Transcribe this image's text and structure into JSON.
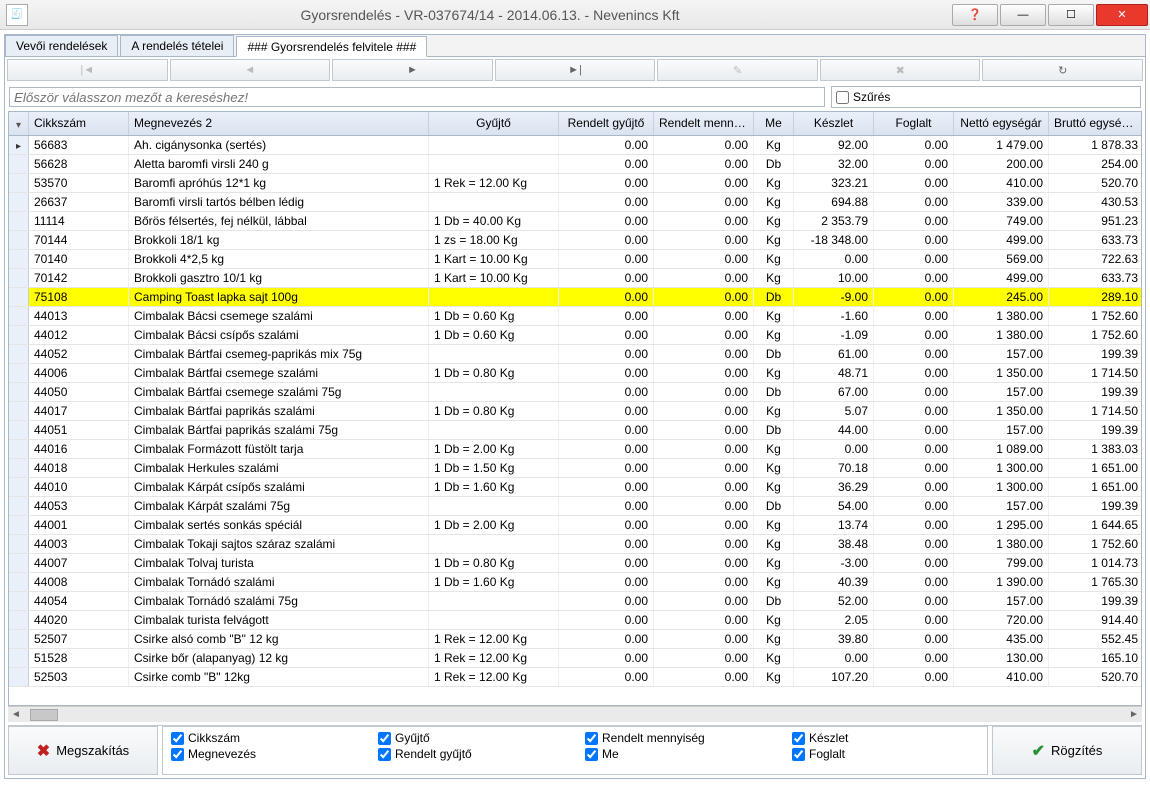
{
  "title": "Gyorsrendelés  -  VR-037674/14  -  2014.06.13.  -  Nevenincs Kft",
  "tabs": [
    {
      "label": "Vevői rendelések"
    },
    {
      "label": "A rendelés tételei"
    },
    {
      "label": "### Gyorsrendelés felvitele ###",
      "active": true
    }
  ],
  "nav": {
    "first": "|◄",
    "prev": "◄",
    "next": "►",
    "last": "►|",
    "edit": "✎",
    "delete": "✖",
    "refresh": "↻"
  },
  "search_placeholder": "Először válasszon mezőt a kereséshez!",
  "filter_label": "Szűrés",
  "columns": [
    "",
    "Cikkszám",
    "Megnevezés  2",
    "Gyűjtő",
    "Rendelt gyűjtő",
    "Rendelt mennyiség",
    "Me",
    "Készlet",
    "Foglalt",
    "Nettó egységár",
    "Bruttó egységár"
  ],
  "rows": [
    {
      "mark": true,
      "c": "56683",
      "n": "Ah. cigánysonka (sertés)",
      "g": "",
      "rg": "0.00",
      "rm": "0.00",
      "me": "Kg",
      "k": "92.00",
      "f": "0.00",
      "ne": "1 479.00",
      "be": "1 878.33"
    },
    {
      "c": "56628",
      "n": "Aletta baromfi virsli 240 g",
      "g": "",
      "rg": "0.00",
      "rm": "0.00",
      "me": "Db",
      "k": "32.00",
      "f": "0.00",
      "ne": "200.00",
      "be": "254.00"
    },
    {
      "c": "53570",
      "n": "Baromfi apróhús 12*1 kg",
      "g": "1 Rek = 12.00 Kg",
      "rg": "0.00",
      "rm": "0.00",
      "me": "Kg",
      "k": "323.21",
      "f": "0.00",
      "ne": "410.00",
      "be": "520.70"
    },
    {
      "c": "26637",
      "n": "Baromfi virsli tartós bélben lédig",
      "g": "",
      "rg": "0.00",
      "rm": "0.00",
      "me": "Kg",
      "k": "694.88",
      "f": "0.00",
      "ne": "339.00",
      "be": "430.53"
    },
    {
      "c": "11114",
      "n": "Bőrös félsertés, fej nélkül, lábbal",
      "g": "1 Db = 40.00 Kg",
      "rg": "0.00",
      "rm": "0.00",
      "me": "Kg",
      "k": "2 353.79",
      "f": "0.00",
      "ne": "749.00",
      "be": "951.23"
    },
    {
      "c": "70144",
      "n": "Brokkoli 18/1 kg",
      "g": "1 zs = 18.00 Kg",
      "rg": "0.00",
      "rm": "0.00",
      "me": "Kg",
      "k": "-18 348.00",
      "f": "0.00",
      "ne": "499.00",
      "be": "633.73"
    },
    {
      "c": "70140",
      "n": "Brokkoli 4*2,5 kg",
      "g": "1 Kart = 10.00 Kg",
      "rg": "0.00",
      "rm": "0.00",
      "me": "Kg",
      "k": "0.00",
      "f": "0.00",
      "ne": "569.00",
      "be": "722.63"
    },
    {
      "c": "70142",
      "n": "Brokkoli gasztro 10/1 kg",
      "g": "1 Kart = 10.00 Kg",
      "rg": "0.00",
      "rm": "0.00",
      "me": "Kg",
      "k": "10.00",
      "f": "0.00",
      "ne": "499.00",
      "be": "633.73"
    },
    {
      "hl": true,
      "c": "75108",
      "n": "Camping Toast lapka sajt 100g",
      "g": "",
      "rg": "0.00",
      "rm": "0.00",
      "me": "Db",
      "k": "-9.00",
      "f": "0.00",
      "ne": "245.00",
      "be": "289.10"
    },
    {
      "c": "44013",
      "n": "Cimbalak Bácsi csemege szalámi",
      "g": "1 Db = 0.60 Kg",
      "rg": "0.00",
      "rm": "0.00",
      "me": "Kg",
      "k": "-1.60",
      "f": "0.00",
      "ne": "1 380.00",
      "be": "1 752.60"
    },
    {
      "c": "44012",
      "n": "Cimbalak Bácsi csípős szalámi",
      "g": "1 Db = 0.60 Kg",
      "rg": "0.00",
      "rm": "0.00",
      "me": "Kg",
      "k": "-1.09",
      "f": "0.00",
      "ne": "1 380.00",
      "be": "1 752.60"
    },
    {
      "c": "44052",
      "n": "Cimbalak Bártfai csemeg-paprikás mix 75g",
      "g": "",
      "rg": "0.00",
      "rm": "0.00",
      "me": "Db",
      "k": "61.00",
      "f": "0.00",
      "ne": "157.00",
      "be": "199.39"
    },
    {
      "c": "44006",
      "n": "Cimbalak Bártfai csemege szalámi",
      "g": "1 Db = 0.80 Kg",
      "rg": "0.00",
      "rm": "0.00",
      "me": "Kg",
      "k": "48.71",
      "f": "0.00",
      "ne": "1 350.00",
      "be": "1 714.50"
    },
    {
      "c": "44050",
      "n": "Cimbalak Bártfai csemege szalámi 75g",
      "g": "",
      "rg": "0.00",
      "rm": "0.00",
      "me": "Db",
      "k": "67.00",
      "f": "0.00",
      "ne": "157.00",
      "be": "199.39"
    },
    {
      "c": "44017",
      "n": "Cimbalak Bártfai paprikás szalámi",
      "g": "1 Db = 0.80 Kg",
      "rg": "0.00",
      "rm": "0.00",
      "me": "Kg",
      "k": "5.07",
      "f": "0.00",
      "ne": "1 350.00",
      "be": "1 714.50"
    },
    {
      "c": "44051",
      "n": "Cimbalak Bártfai paprikás szalámi 75g",
      "g": "",
      "rg": "0.00",
      "rm": "0.00",
      "me": "Db",
      "k": "44.00",
      "f": "0.00",
      "ne": "157.00",
      "be": "199.39"
    },
    {
      "c": "44016",
      "n": "Cimbalak Formázott füstölt tarja",
      "g": "1 Db = 2.00 Kg",
      "rg": "0.00",
      "rm": "0.00",
      "me": "Kg",
      "k": "0.00",
      "f": "0.00",
      "ne": "1 089.00",
      "be": "1 383.03"
    },
    {
      "c": "44018",
      "n": "Cimbalak Herkules szalámi",
      "g": "1 Db = 1.50 Kg",
      "rg": "0.00",
      "rm": "0.00",
      "me": "Kg",
      "k": "70.18",
      "f": "0.00",
      "ne": "1 300.00",
      "be": "1 651.00"
    },
    {
      "c": "44010",
      "n": "Cimbalak Kárpát csípős szalámi",
      "g": "1 Db = 1.60 Kg",
      "rg": "0.00",
      "rm": "0.00",
      "me": "Kg",
      "k": "36.29",
      "f": "0.00",
      "ne": "1 300.00",
      "be": "1 651.00"
    },
    {
      "c": "44053",
      "n": "Cimbalak Kárpát szalámi 75g",
      "g": "",
      "rg": "0.00",
      "rm": "0.00",
      "me": "Db",
      "k": "54.00",
      "f": "0.00",
      "ne": "157.00",
      "be": "199.39"
    },
    {
      "c": "44001",
      "n": "Cimbalak sertés sonkás spéciál",
      "g": "1 Db = 2.00 Kg",
      "rg": "0.00",
      "rm": "0.00",
      "me": "Kg",
      "k": "13.74",
      "f": "0.00",
      "ne": "1 295.00",
      "be": "1 644.65"
    },
    {
      "c": "44003",
      "n": "Cimbalak Tokaji sajtos száraz szalámi",
      "g": "",
      "rg": "0.00",
      "rm": "0.00",
      "me": "Kg",
      "k": "38.48",
      "f": "0.00",
      "ne": "1 380.00",
      "be": "1 752.60"
    },
    {
      "c": "44007",
      "n": "Cimbalak Tolvaj turista",
      "g": "1 Db = 0.80 Kg",
      "rg": "0.00",
      "rm": "0.00",
      "me": "Kg",
      "k": "-3.00",
      "f": "0.00",
      "ne": "799.00",
      "be": "1 014.73"
    },
    {
      "c": "44008",
      "n": "Cimbalak Tornádó szalámi",
      "g": "1 Db = 1.60 Kg",
      "rg": "0.00",
      "rm": "0.00",
      "me": "Kg",
      "k": "40.39",
      "f": "0.00",
      "ne": "1 390.00",
      "be": "1 765.30"
    },
    {
      "c": "44054",
      "n": "Cimbalak Tornádó szalámi 75g",
      "g": "",
      "rg": "0.00",
      "rm": "0.00",
      "me": "Db",
      "k": "52.00",
      "f": "0.00",
      "ne": "157.00",
      "be": "199.39"
    },
    {
      "c": "44020",
      "n": "Cimbalak turista felvágott",
      "g": "",
      "rg": "0.00",
      "rm": "0.00",
      "me": "Kg",
      "k": "2.05",
      "f": "0.00",
      "ne": "720.00",
      "be": "914.40"
    },
    {
      "c": "52507",
      "n": "Csirke alsó comb \"B\" 12 kg",
      "g": "1 Rek = 12.00 Kg",
      "rg": "0.00",
      "rm": "0.00",
      "me": "Kg",
      "k": "39.80",
      "f": "0.00",
      "ne": "435.00",
      "be": "552.45"
    },
    {
      "c": "51528",
      "n": "Csirke bőr (alapanyag) 12 kg",
      "g": "1 Rek = 12.00 Kg",
      "rg": "0.00",
      "rm": "0.00",
      "me": "Kg",
      "k": "0.00",
      "f": "0.00",
      "ne": "130.00",
      "be": "165.10"
    },
    {
      "c": "52503",
      "n": "Csirke comb \"B\" 12kg",
      "g": "1 Rek = 12.00 Kg",
      "rg": "0.00",
      "rm": "0.00",
      "me": "Kg",
      "k": "107.20",
      "f": "0.00",
      "ne": "410.00",
      "be": "520.70"
    }
  ],
  "checks": [
    "Cikkszám",
    "Gyűjtő",
    "Rendelt mennyiség",
    "Készlet",
    "Megnevezés",
    "Rendelt gyűjtő",
    "Me",
    "Foglalt"
  ],
  "buttons": {
    "cancel": "Megszakítás",
    "save": "Rögzítés"
  }
}
